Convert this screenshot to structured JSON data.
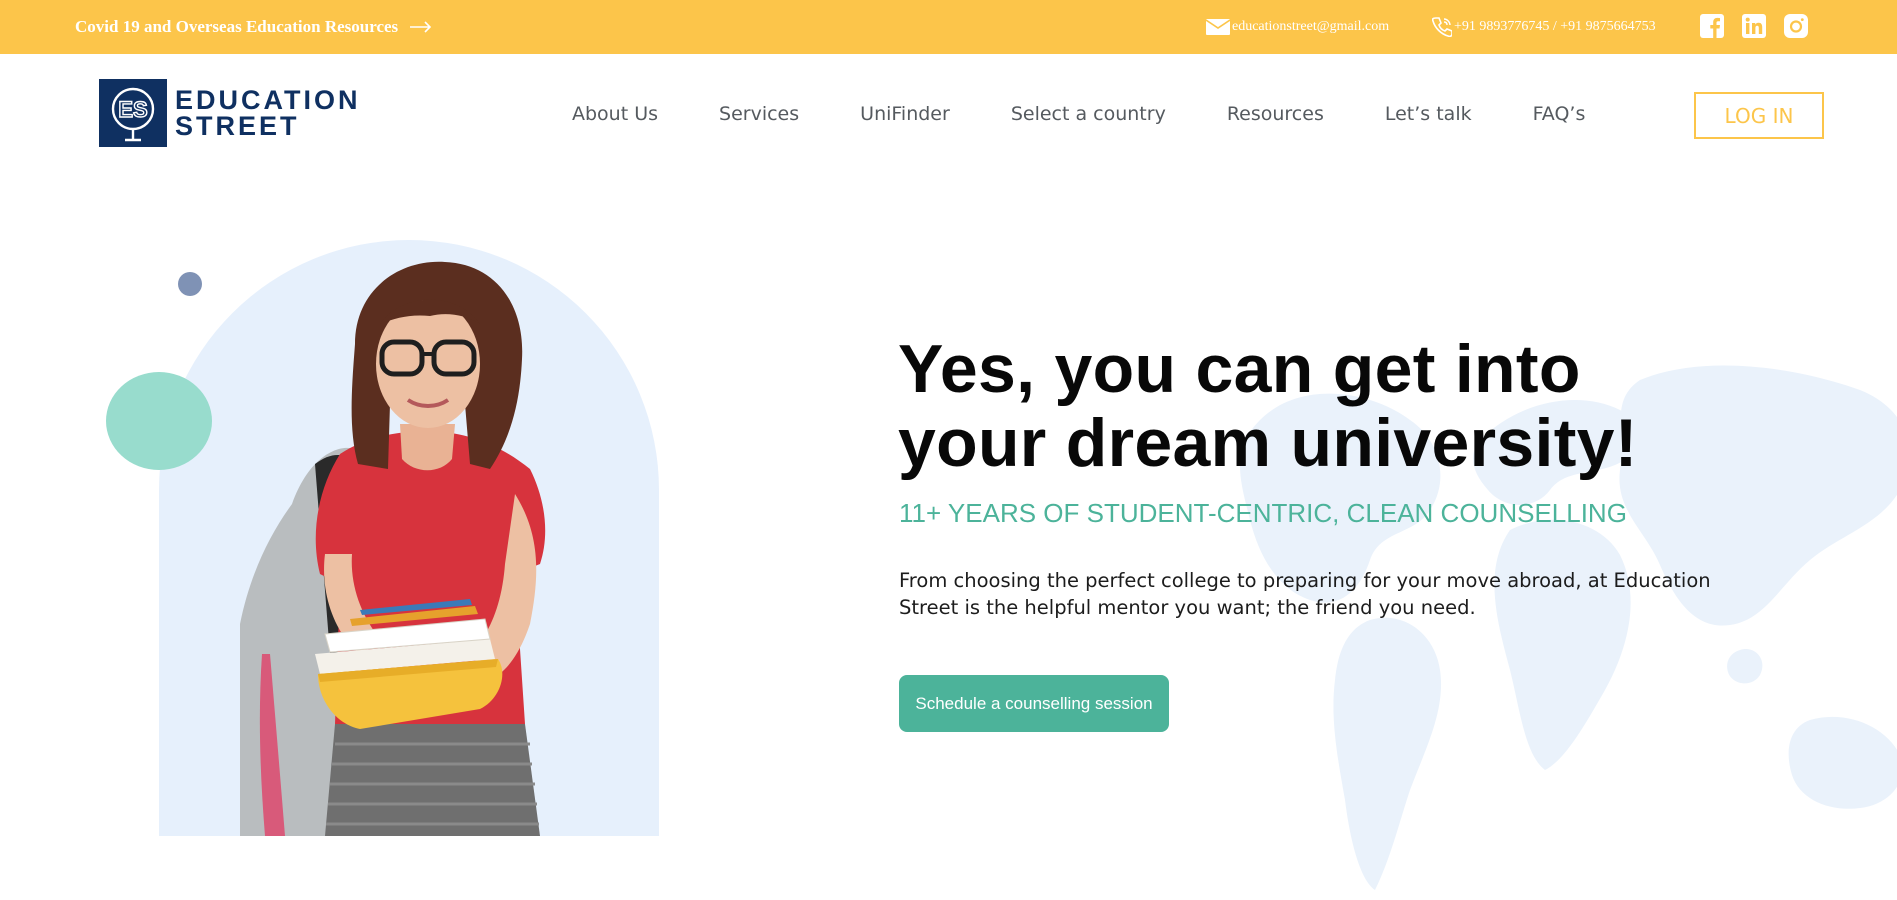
{
  "topbar": {
    "promo_label": "Covid 19 and Overseas Education Resources",
    "email": "educationstreet@gmail.com",
    "phone": "+91 9893776745 / +91 9875664753",
    "social_icons": [
      "facebook-icon",
      "linkedin-icon",
      "instagram-icon"
    ]
  },
  "header": {
    "logo": {
      "line1": "EDUCATION",
      "line2": "STREET",
      "mark": "ES"
    },
    "nav": [
      "About Us",
      "Services",
      "UniFinder",
      "Select a country",
      "Resources",
      "Let’s talk",
      "FAQ’s"
    ],
    "login_label": "LOG IN"
  },
  "hero": {
    "title_line1": "Yes, you can get into",
    "title_line2": "your dream university!",
    "subtitle": "11+ YEARS OF STUDENT-CENTRIC, CLEAN COUNSELLING",
    "description": "From choosing the perfect college to preparing for your move abroad, at Education Street is the helpful mentor you want; the friend you need.",
    "cta_label": "Schedule a counselling session"
  },
  "colors": {
    "topbar_bg": "#fcc54a",
    "brand_navy": "#0f3061",
    "accent_teal": "#4cb39a",
    "arch_bg": "#e6f0fc",
    "nav_text": "#555a5f"
  }
}
